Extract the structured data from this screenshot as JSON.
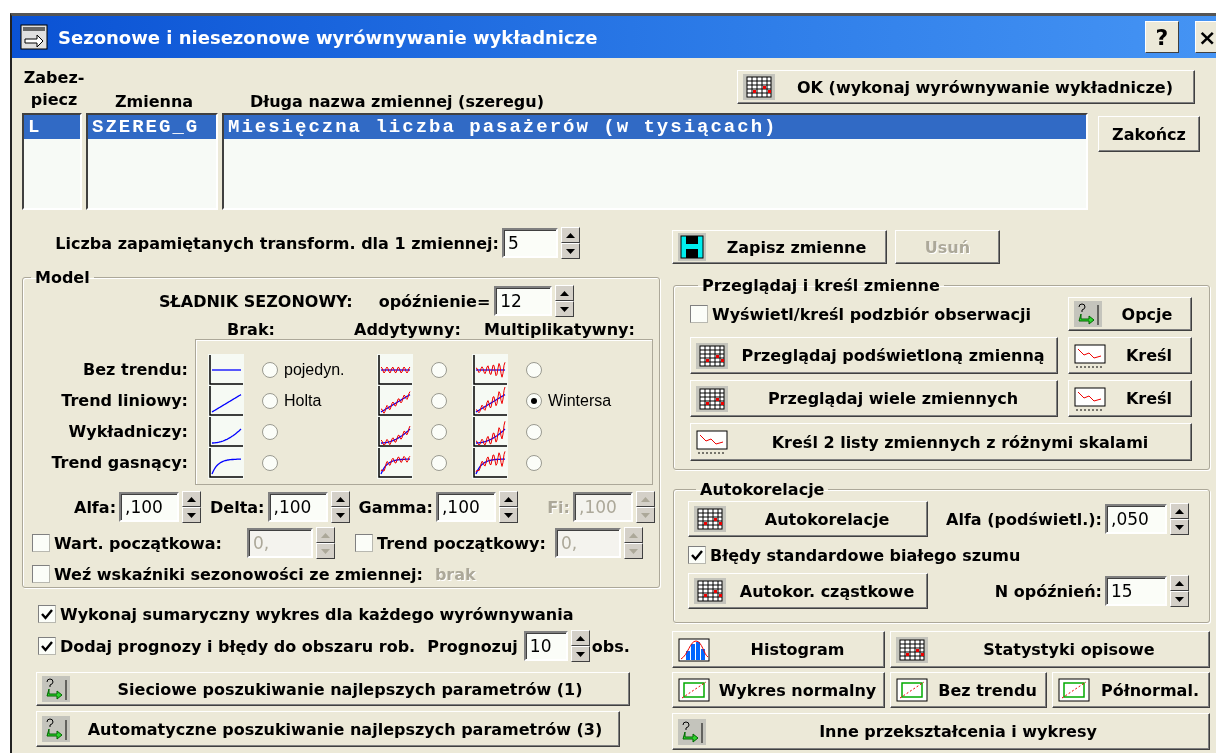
{
  "window": {
    "title": "Sezonowe i niesezonowe wyrównywanie wykładnicze",
    "help": "?",
    "close": "×"
  },
  "variables": {
    "columns": [
      "Zabez-piecz",
      "Zmienna",
      "Długa nazwa zmiennej (szeregu)"
    ],
    "rows": [
      {
        "cells": [
          "L",
          "SZEREG_G",
          "Miesięczna liczba pasażerów (w tysiącach)"
        ],
        "selected": true
      }
    ]
  },
  "ok_button": {
    "label": "OK (wykonaj wyrównywanie wykładnicze)",
    "kind": "grid"
  },
  "close_button": {
    "label": "Zakończ"
  },
  "transforms": {
    "label": "Liczba zapamiętanych transform. dla 1 zmiennej:",
    "value": "5"
  },
  "model": {
    "title": "Model",
    "seasonal_label": "SŁADNIK SEZONOWY:",
    "lag_label": "opóźnienie=",
    "lag": "12",
    "columns": [
      "Brak:",
      "Addytywny:",
      "Multiplikatywny:"
    ],
    "rows": [
      {
        "label": "Bez trendu:",
        "options": [
          {
            "label": "pojedyn.",
            "selected": false
          },
          {
            "selected": false
          },
          {
            "selected": false
          }
        ]
      },
      {
        "label": "Trend liniowy:",
        "options": [
          {
            "label": "Holta",
            "selected": false
          },
          {
            "selected": false
          },
          {
            "label": "Wintersa",
            "selected": true
          }
        ]
      },
      {
        "label": "Wykładniczy:",
        "options": [
          {
            "selected": false
          },
          {
            "selected": false
          },
          {
            "selected": false
          }
        ]
      },
      {
        "label": "Trend gasnący:",
        "options": [
          {
            "selected": false
          },
          {
            "selected": false
          },
          {
            "selected": false
          }
        ]
      }
    ],
    "params": [
      {
        "label": "Alfa:",
        "value": ",100",
        "disabled": false
      },
      {
        "label": "Delta:",
        "value": ",100",
        "disabled": false
      },
      {
        "label": "Gamma:",
        "value": ",100",
        "disabled": false
      },
      {
        "label": "Fi:",
        "value": ",100",
        "disabled": true
      }
    ],
    "initial": [
      {
        "label": "Wart. początkowa:",
        "checked": false,
        "value": "0,",
        "disabled": true
      },
      {
        "label": "Trend początkowy:",
        "checked": false,
        "value": "0,",
        "disabled": true
      }
    ],
    "seasonal_indices": {
      "label": "Weź wskaźniki sezonowości ze zmiennej:",
      "checked": false,
      "value": "brak"
    }
  },
  "options": [
    {
      "label": "Wykonaj sumaryczny wykres dla każdego wyrównywania",
      "checked": true
    },
    {
      "label": "Dodaj prognozy i błędy do obszaru rob.",
      "checked": true
    }
  ],
  "forecast": {
    "label": "Prognozuj",
    "value": "10",
    "unit": "obs."
  },
  "search_buttons": [
    {
      "label": "Sieciowe poszukiwanie najlepszych parametrów (1)",
      "kind": "options"
    },
    {
      "label": "Automatyczne poszukiwanie najlepszych parametrów (3)",
      "kind": "options"
    }
  ],
  "save_buttons": [
    {
      "label": "Zapisz zmienne",
      "kind": "disk",
      "disabled": false
    },
    {
      "label": "Usuń",
      "disabled": true
    }
  ],
  "browse": {
    "title": "Przeglądaj i kreśl zmienne",
    "subset": {
      "label": "Wyświetl/kreśl podzbiór obserwacji",
      "checked": false
    },
    "buttons": [
      {
        "label": "Opcje",
        "kind": "options"
      },
      {
        "label": "Przeglądaj podświetloną zmienną",
        "kind": "grid"
      },
      {
        "label": "Kreśl",
        "kind": "plot"
      },
      {
        "label": "Przeglądaj wiele zmiennych",
        "kind": "grid"
      },
      {
        "label": "Kreśl",
        "kind": "plot"
      },
      {
        "label": "Kreśl 2 listy zmiennych z różnymi skalami",
        "kind": "plot"
      }
    ]
  },
  "autocorrelation": {
    "title": "Autokorelacje",
    "acf_button": {
      "label": "Autokorelacje",
      "kind": "grid"
    },
    "alpha": {
      "label": "Alfa (podświetl.):",
      "value": ",050"
    },
    "white_noise": {
      "label": "Błędy standardowe białego szumu",
      "checked": true
    },
    "pacf_button": {
      "label": "Autokor. cząstkowe",
      "kind": "grid"
    },
    "lags": {
      "label": "N opóźnień:",
      "value": "15"
    }
  },
  "plot_buttons": [
    {
      "label": "Histogram",
      "kind": "histogram"
    },
    {
      "label": "Statystyki opisowe",
      "kind": "grid"
    },
    {
      "label": "Wykres normalny",
      "kind": "normal"
    },
    {
      "label": "Bez trendu",
      "kind": "normal"
    },
    {
      "label": "Półnormal.",
      "kind": "normal"
    },
    {
      "label": "Inne przekształcenia i wykresy",
      "kind": "options"
    }
  ]
}
